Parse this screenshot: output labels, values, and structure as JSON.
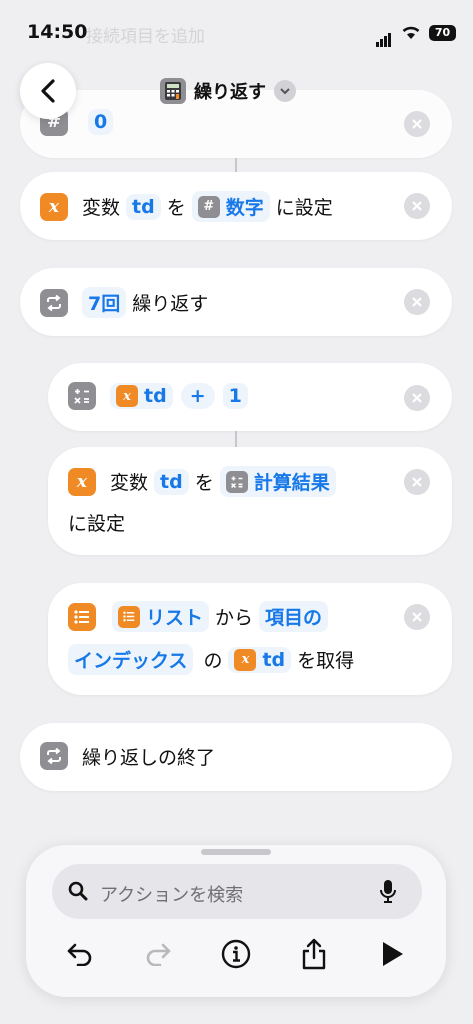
{
  "status_bar": {
    "time": "14:50",
    "ghost_text": "接続項目を追加",
    "battery": "70"
  },
  "header": {
    "title": "繰り返す",
    "back": "back"
  },
  "actions": {
    "number": {
      "value": "0"
    },
    "set_var": {
      "prefix": "変数",
      "var_name": "td",
      "mid": "を",
      "value_token": "数字",
      "suffix": "に設定"
    },
    "repeat": {
      "count": "7回",
      "label": "繰り返す"
    },
    "calc": {
      "var_name": "td",
      "operator": "+",
      "operand": "1"
    },
    "set_var2": {
      "prefix": "変数",
      "var_name": "td",
      "mid": "を",
      "value_token": "計算結果",
      "suffix": "に設定"
    },
    "get_item": {
      "list_token": "リスト",
      "from": "から",
      "item_token_1": "項目の",
      "item_token_2": "インデックス",
      "of": "の",
      "var_name": "td",
      "suffix": "を取得"
    },
    "end_repeat": {
      "label": "繰り返しの終了"
    }
  },
  "search": {
    "placeholder": "アクションを検索"
  },
  "toolbar": [
    "undo",
    "redo",
    "info",
    "share",
    "run"
  ],
  "colors": {
    "accent": "#1778e8",
    "variable_orange": "#f08a24",
    "icon_gray": "#8e8e93"
  }
}
